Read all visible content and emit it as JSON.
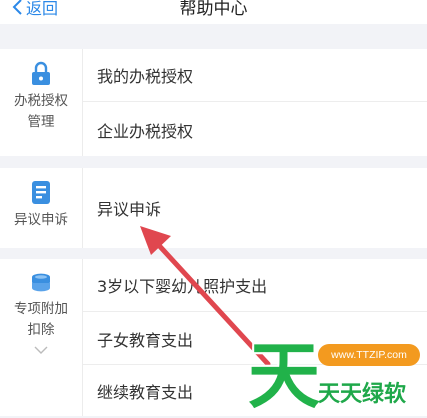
{
  "header": {
    "back_label": "返回",
    "title": "帮助中心"
  },
  "sections": [
    {
      "category": "办税授权\n管理",
      "items": [
        "我的办税授权",
        "企业办税授权"
      ]
    },
    {
      "category": "异议申诉",
      "items": [
        "异议申诉"
      ]
    },
    {
      "category": "专项附加\n扣除",
      "items": [
        "3岁以下婴幼儿照护支出",
        "子女教育支出",
        "继续教育支出"
      ]
    }
  ],
  "watermark": {
    "glyph": "天",
    "url": "www.TTZIP.com",
    "brand": "天天绿软"
  },
  "colors": {
    "accent": "#2b88e8",
    "arrow": "#e0474f",
    "watermark_green": "#21b24a",
    "watermark_orange": "#f39a1f"
  }
}
